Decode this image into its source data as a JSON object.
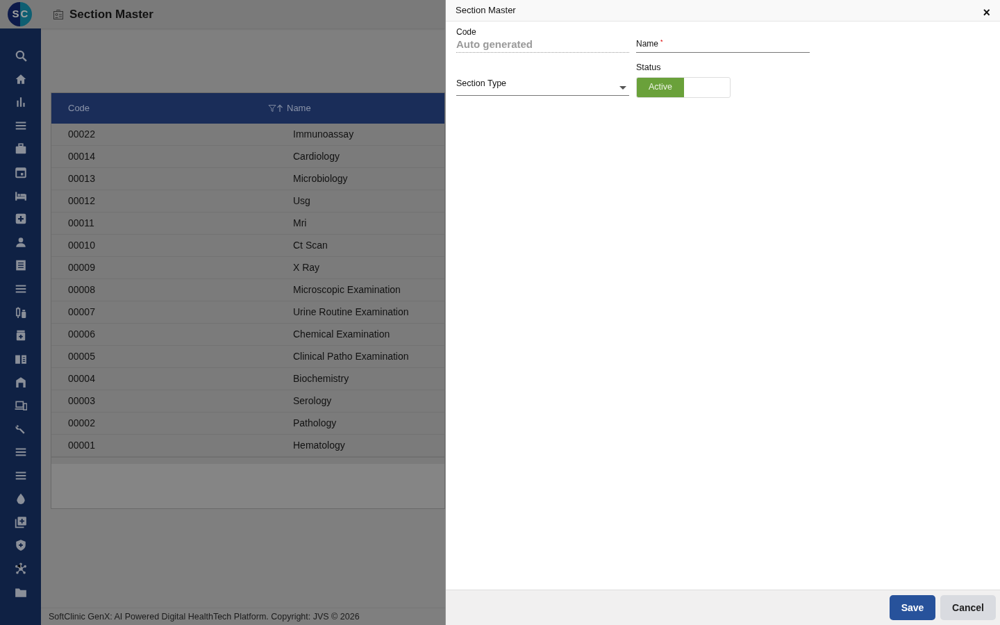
{
  "app": {
    "logo_left": "S",
    "logo_right": "C",
    "page_title": "Section Master"
  },
  "table": {
    "columns": [
      "Code",
      "Name"
    ],
    "rows": [
      {
        "code": "00022",
        "name": "Immunoassay"
      },
      {
        "code": "00014",
        "name": "Cardiology"
      },
      {
        "code": "00013",
        "name": "Microbiology"
      },
      {
        "code": "00012",
        "name": "Usg"
      },
      {
        "code": "00011",
        "name": "Mri"
      },
      {
        "code": "00010",
        "name": "Ct Scan"
      },
      {
        "code": "00009",
        "name": "X Ray"
      },
      {
        "code": "00008",
        "name": "Microscopic Examination"
      },
      {
        "code": "00007",
        "name": "Urine Routine Examination"
      },
      {
        "code": "00006",
        "name": "Chemical Examination"
      },
      {
        "code": "00005",
        "name": "Clinical Patho Examination"
      },
      {
        "code": "00004",
        "name": "Biochemistry"
      },
      {
        "code": "00003",
        "name": "Serology"
      },
      {
        "code": "00002",
        "name": "Pathology"
      },
      {
        "code": "00001",
        "name": "Hematology"
      }
    ]
  },
  "footer": "SoftClinic GenX: AI Powered Digital HealthTech Platform. Copyright: JVS © 2026",
  "dialog": {
    "title": "Section Master",
    "close": "×",
    "code": {
      "label": "Code",
      "value": "Auto generated"
    },
    "name": {
      "label": "Name",
      "required_mark": "*"
    },
    "section_type": {
      "label": "Section Type"
    },
    "status": {
      "label": "Status",
      "option": "Active",
      "on": true
    },
    "buttons": [
      "Save",
      "Cancel"
    ]
  }
}
